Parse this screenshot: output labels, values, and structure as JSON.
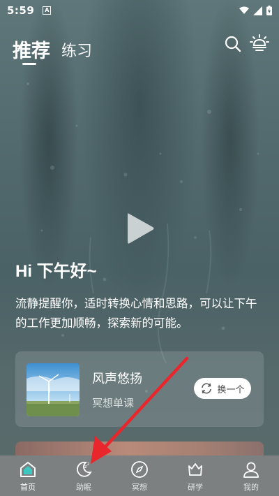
{
  "status_bar": {
    "time": "5:59",
    "notification_badge": "A"
  },
  "top_nav": {
    "tabs": [
      {
        "label": "推荐",
        "active": true
      },
      {
        "label": "练习",
        "active": false
      }
    ]
  },
  "hero": {
    "greeting": "Hi 下午好~",
    "description": "流静提醒你，适时转换心情和思路，可以让下午的工作更加顺畅，探索新的可能。"
  },
  "card": {
    "title": "风声悠扬",
    "subtitle": "冥想单课",
    "swap_label": "换一个"
  },
  "tab_bar": {
    "items": [
      {
        "label": "首页",
        "icon": "home-icon",
        "active": true
      },
      {
        "label": "助眠",
        "icon": "sleep-moon-icon",
        "active": false
      },
      {
        "label": "冥想",
        "icon": "compass-icon",
        "active": false
      },
      {
        "label": "研学",
        "icon": "crown-icon",
        "active": false
      },
      {
        "label": "我的",
        "icon": "user-icon",
        "active": false
      }
    ]
  },
  "colors": {
    "annotation_arrow": "#e8262b",
    "tab_bar_bg": "#7d8080"
  }
}
